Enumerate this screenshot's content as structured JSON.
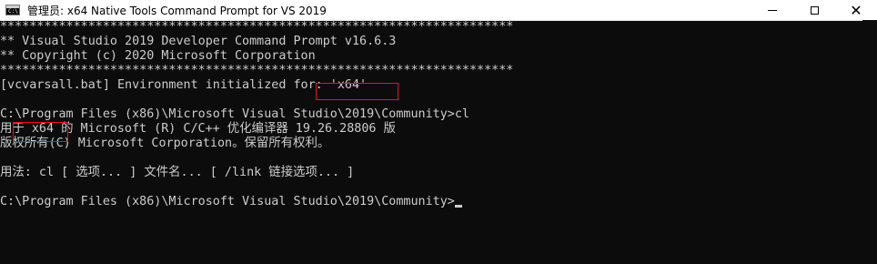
{
  "window": {
    "title": "管理员: x64 Native Tools Command Prompt for VS 2019",
    "icon": "cmd-icon",
    "icon_text": "C:\\",
    "controls": {
      "minimize": "minimize-icon",
      "maximize": "maximize-icon",
      "close_glyph": "✕"
    }
  },
  "console": {
    "lines": [
      "**********************************************************************",
      "** Visual Studio 2019 Developer Command Prompt v16.6.3",
      "** Copyright (c) 2020 Microsoft Corporation",
      "**********************************************************************",
      "[vcvarsall.bat] Environment initialized for: 'x64'",
      "",
      "C:\\Program Files (x86)\\Microsoft Visual Studio\\2019\\Community>cl",
      "用于 x64 的 Microsoft (R) C/C++ 优化编译器 19.26.28806 版",
      "版权所有(C) Microsoft Corporation。保留所有权利。",
      "",
      "用法: cl [ 选项... ] 文件名... [ /link 链接选项... ]",
      "",
      "C:\\Program Files (x86)\\Microsoft Visual Studio\\2019\\Community>"
    ]
  },
  "colors": {
    "background": "#0c0c0c",
    "foreground": "#cccccc",
    "highlight_box": "#e81123",
    "titlebar": "#ffffff"
  }
}
